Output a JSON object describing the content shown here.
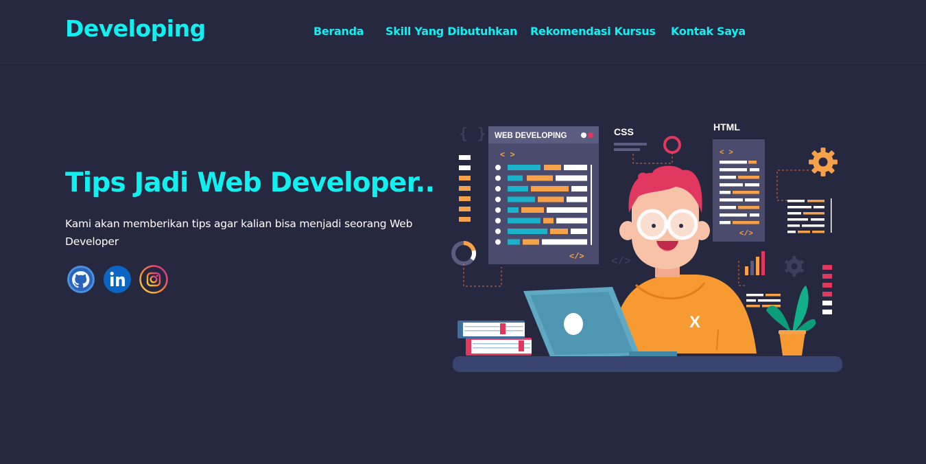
{
  "header": {
    "logo": "Developing",
    "nav": [
      {
        "label": "Beranda"
      },
      {
        "label": "Skill Yang Dibutuhkan"
      },
      {
        "label": "Rekomendasi Kursus"
      },
      {
        "label": "Kontak Saya"
      }
    ]
  },
  "hero": {
    "title": "Tips Jadi Web Developer..",
    "description": "Kami akan memberikan tips agar kalian bisa menjadi seorang Web Developer",
    "socials": [
      {
        "icon": "github-icon"
      },
      {
        "icon": "linkedin-icon"
      },
      {
        "icon": "instagram-icon"
      }
    ]
  },
  "illustration": {
    "window_title": "WEB DEVELOPING",
    "css_label": "CSS",
    "html_label": "HTML",
    "code_open": "< >",
    "code_close": "</>",
    "shirt_letter": "X"
  },
  "colors": {
    "background": "#262840",
    "accent": "#10f0f0",
    "text": "#ffffff",
    "orange": "#f7a14b",
    "teal": "#1ab3c9",
    "panel": "#4b4c6d"
  }
}
